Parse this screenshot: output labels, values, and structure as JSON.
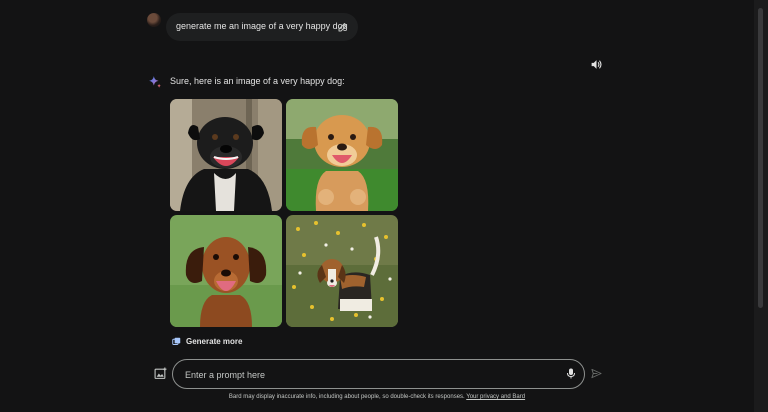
{
  "conversation": {
    "user_prompt": "generate me an image of a very happy dog",
    "response_text": "Sure, here is an image of a very happy dog:",
    "images": [
      {
        "subject": "black dog with open mouth"
      },
      {
        "subject": "golden puppy running on grass"
      },
      {
        "subject": "brown dachshund on green background"
      },
      {
        "subject": "beagle puppy in a flower field"
      }
    ],
    "generate_more_label": "Generate more"
  },
  "composer": {
    "placeholder": "Enter a prompt here"
  },
  "footer": {
    "disclaimer": "Bard may display inaccurate info, including about people, so double-check its responses.",
    "link_text": "Your privacy and Bard"
  },
  "icons": {
    "edit": "pencil-icon",
    "speaker": "speaker-icon",
    "sparkle": "bard-sparkle-icon",
    "generate_more": "images-icon",
    "upload": "image-upload-icon",
    "mic": "microphone-icon",
    "send": "send-icon"
  },
  "colors": {
    "background": "#131314",
    "bubble": "#1e1f20",
    "text": "#e3e3e3",
    "sparkle_blue": "#4285f4",
    "sparkle_red": "#d96570"
  }
}
